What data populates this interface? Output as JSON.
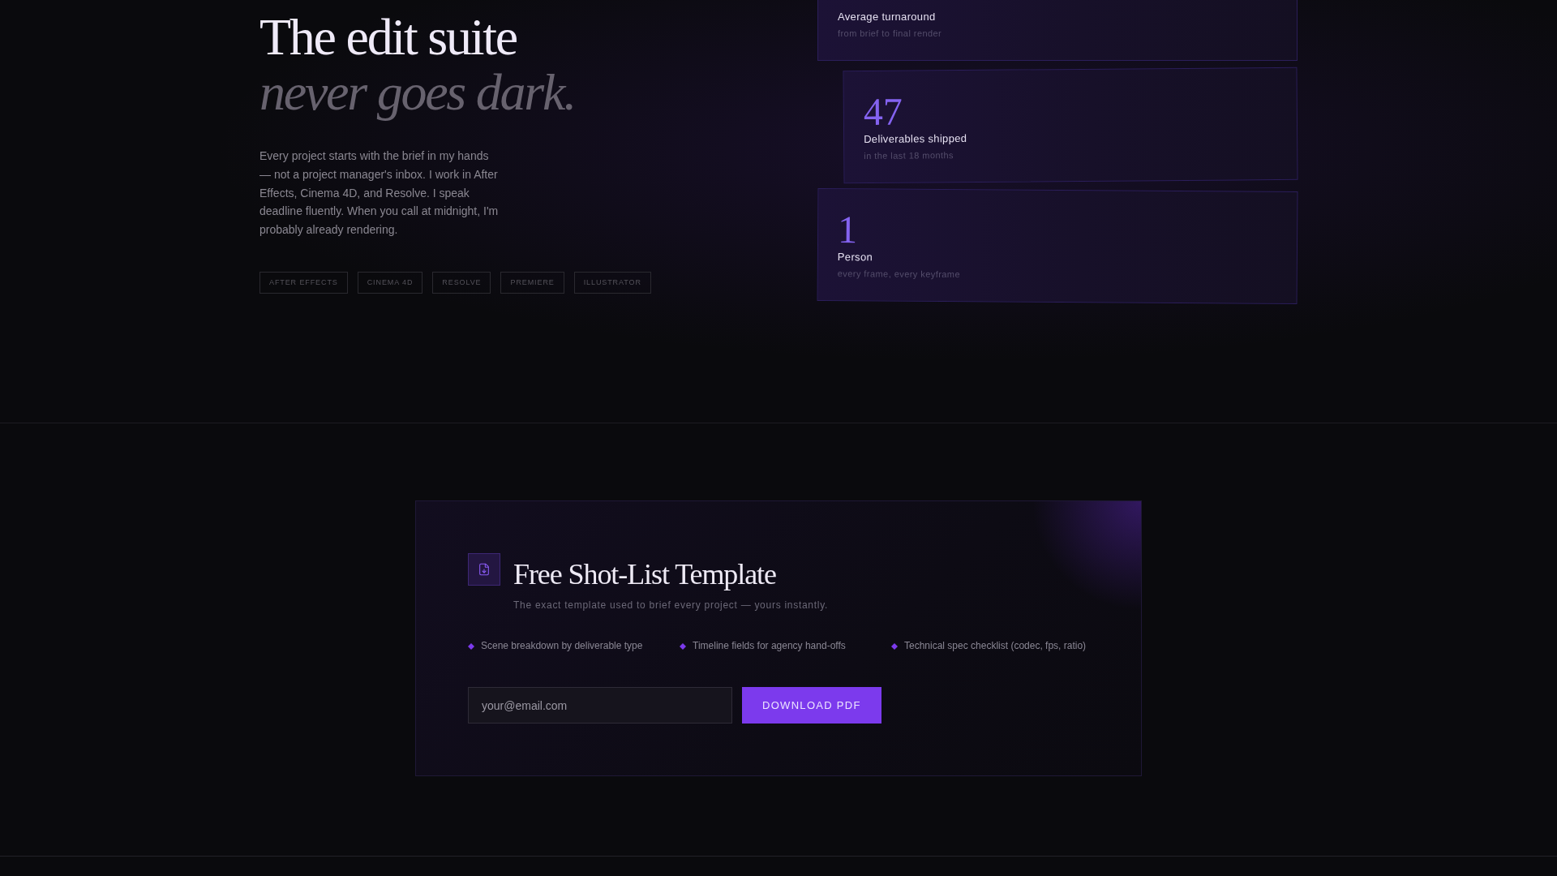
{
  "hero": {
    "headline": "The edit suite",
    "headline_accent": "never goes dark.",
    "intro": "Every project starts with the brief in my hands — not a project manager's inbox. I work in After Effects, Cinema 4D, and Resolve. I speak deadline fluently. When you call at midnight, I'm probably already rendering.",
    "tools": [
      "AFTER EFFECTS",
      "CINEMA 4D",
      "RESOLVE",
      "PREMIERE",
      "ILLUSTRATOR"
    ]
  },
  "stats": [
    {
      "label": "Average turnaround",
      "note": "from brief to final render"
    },
    {
      "value": "47",
      "label": "Deliverables shipped",
      "note": "in the last 18 months"
    },
    {
      "value": "1",
      "label": "Person",
      "note": "every frame, every keyframe"
    }
  ],
  "lead_magnet": {
    "title": "Free Shot-List Template",
    "subtitle": "The exact template used to brief every project — yours instantly.",
    "features": [
      "Scene breakdown by deliverable type",
      "Timeline fields for agency hand-offs",
      "Technical spec checklist (codec, fps, ratio)"
    ],
    "email_field": {
      "placeholder": "your@email.com"
    },
    "button": "DOWNLOAD PDF"
  }
}
